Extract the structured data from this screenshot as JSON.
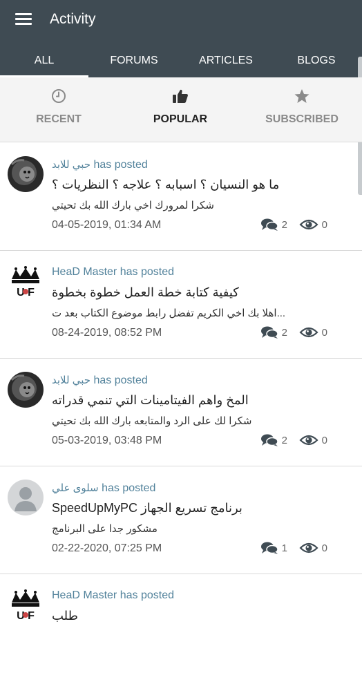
{
  "app": {
    "title": "Activity"
  },
  "tabs": [
    {
      "label": "ALL"
    },
    {
      "label": "FORUMS"
    },
    {
      "label": "ARTICLES"
    },
    {
      "label": "BLOGS"
    }
  ],
  "filters": [
    {
      "label": "RECENT",
      "icon": "clock-icon"
    },
    {
      "label": "POPULAR",
      "icon": "thumbs-up-icon"
    },
    {
      "label": "SUBSCRIBED",
      "icon": "star-icon"
    }
  ],
  "colors": {
    "header": "#3f4b53",
    "accent": "#52829b"
  },
  "posts": [
    {
      "author": "حبي للابد",
      "action": "has posted",
      "title": "ما هو النسيان ؟ اسبابه ؟ علاجه ؟ النظريات ؟",
      "reply": "شكرا لمرورك اخي  بارك الله بك  تحيتي",
      "date": "04-05-2019, 01:34 AM",
      "comments": "2",
      "views": "0",
      "avatar": "lion-photo"
    },
    {
      "author": "HeaD Master",
      "action": "has posted",
      "title": "كيفية كتابة خطة العمل خطوة بخطوة",
      "reply": "...اهلا بك اخي الكريم   تفضل رابط موضوع الكتاب بعد ت",
      "date": "08-24-2019, 08:52 PM",
      "comments": "2",
      "views": "0",
      "avatar": "crown-logo"
    },
    {
      "author": "حبي للابد",
      "action": "has posted",
      "title": "المخ واهم الفيتامينات التي تنمي قدراته",
      "reply": "شكرا لك على الرد والمتابعه  بارك الله بك  تحيتي",
      "date": "05-03-2019, 03:48 PM",
      "comments": "2",
      "views": "0",
      "avatar": "lion-photo"
    },
    {
      "author": "سلوى علي",
      "action": "has posted",
      "title": "برنامج تسريع الجهاز SpeedUpMyPC",
      "reply": "مشكور جدا على البرنامج",
      "date": "02-22-2020, 07:25 PM",
      "comments": "1",
      "views": "0",
      "avatar": "default-user"
    },
    {
      "author": "HeaD Master",
      "action": "has posted",
      "title": "طلب",
      "reply": "",
      "date": "",
      "comments": "",
      "views": "",
      "avatar": "crown-logo"
    }
  ]
}
